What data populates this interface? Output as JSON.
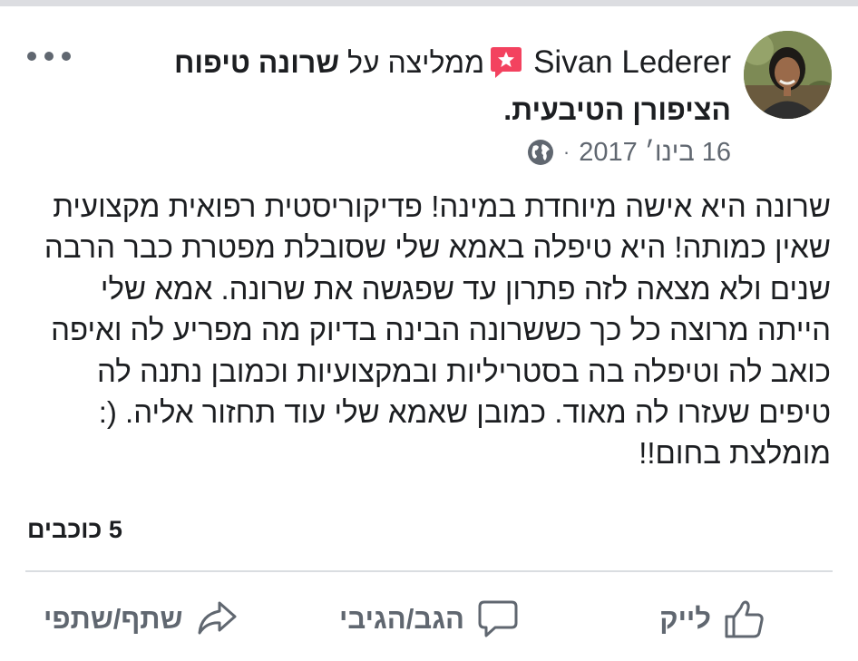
{
  "post": {
    "author": "Sivan Lederer",
    "recommends_text": "ממליצה על",
    "page_name_part1": "שרונה טיפוח",
    "page_name_part2": "הציפורן הטיבעית.",
    "date": "16 בינו׳ 2017",
    "date_separator": "·",
    "audience_icon": "globe-icon",
    "body_lines": [
      "שרונה היא אישה מיוחדת במינה! פדיקוריסטית רפואית מקצועית",
      "שאין כמותה! היא טיפלה באמא שלי שסובלת מפטרת כבר הרבה",
      "שנים ולא מצאה לזה פתרון עד שפגשה את שרונה. אמא שלי",
      "הייתה מרוצה כל כך כששרונה הבינה בדיוק מה מפריע לה ואיפה",
      "כואב לה וטיפלה בה בסטריליות ובמקצועיות וכמובן נתנה לה",
      "טיפים שעזרו לה מאוד.  כמובן שאמא שלי עוד תחזור אליה. (:",
      "מומלצת בחום!!"
    ],
    "rating": "5 כוכבים"
  },
  "actions": {
    "like": "לייק",
    "comment": "הגב/הגיבי",
    "share": "שתף/שתפי"
  },
  "colors": {
    "text": "#1c1e21",
    "secondary": "#606770",
    "recommend_badge": "#f3425f",
    "divider": "#dadde1"
  }
}
